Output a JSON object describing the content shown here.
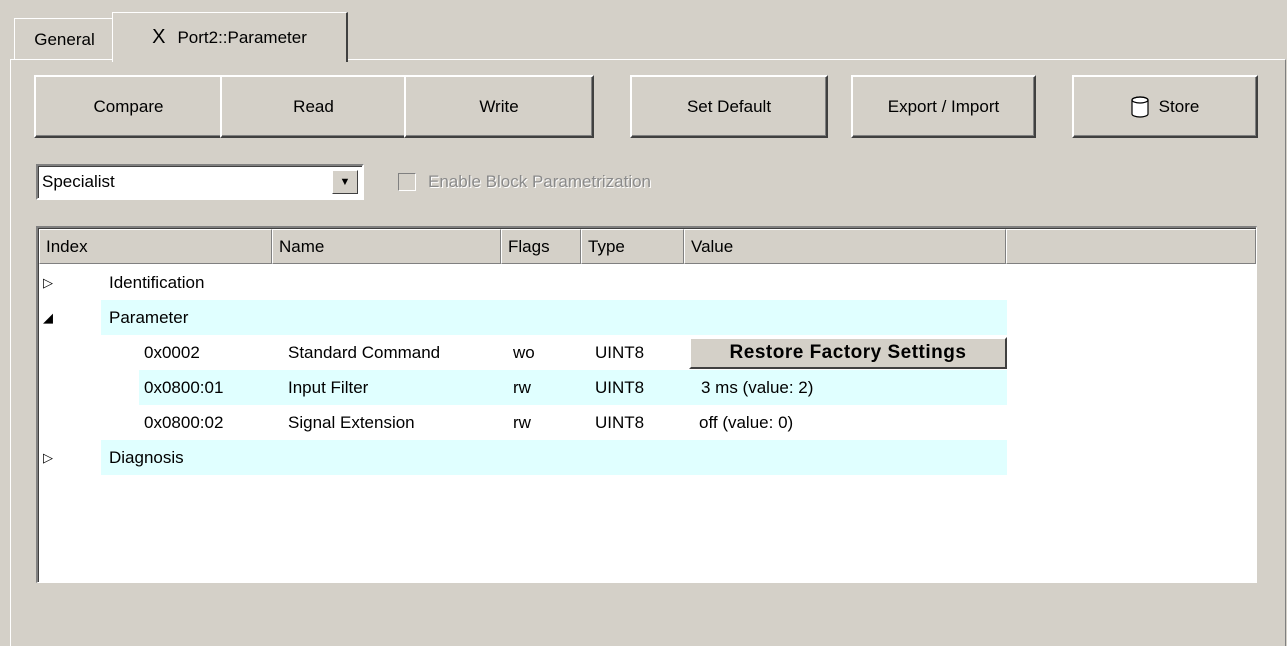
{
  "tabs": [
    {
      "label": "General"
    },
    {
      "close": "X",
      "label": "Port2::Parameter"
    }
  ],
  "toolbar": {
    "compare": "Compare",
    "read": "Read",
    "write": "Write",
    "set_default": "Set Default",
    "export_import": "Export / Import",
    "store": "Store"
  },
  "mode_select": {
    "value": "Specialist",
    "arrow": "▼"
  },
  "block_checkbox": {
    "label": "Enable Block Parametrization",
    "checked": false,
    "enabled": false
  },
  "table": {
    "columns": [
      "Index",
      "Name",
      "Flags",
      "Type",
      "Value",
      ""
    ],
    "rows": [
      {
        "kind": "group",
        "toggle": "▷",
        "label": "Identification",
        "expanded": false
      },
      {
        "kind": "group",
        "toggle": "◢",
        "label": "Parameter",
        "expanded": true
      },
      {
        "kind": "item",
        "index": "0x0002",
        "name": "Standard Command",
        "flags": "wo",
        "type": "UINT8",
        "value": "Restore Factory Settings",
        "value_is_button": true
      },
      {
        "kind": "item",
        "index": "0x0800:01",
        "name": "Input Filter",
        "flags": "rw",
        "type": "UINT8",
        "value": "3 ms (value: 2)"
      },
      {
        "kind": "item",
        "index": "0x0800:02",
        "name": "Signal Extension",
        "flags": "rw",
        "type": "UINT8",
        "value": "off (value: 0)"
      },
      {
        "kind": "group",
        "toggle": "▷",
        "label": "Diagnosis",
        "expanded": false
      }
    ]
  },
  "colors": {
    "background": "#d4d0c8",
    "row_highlight": "#e0ffff"
  }
}
